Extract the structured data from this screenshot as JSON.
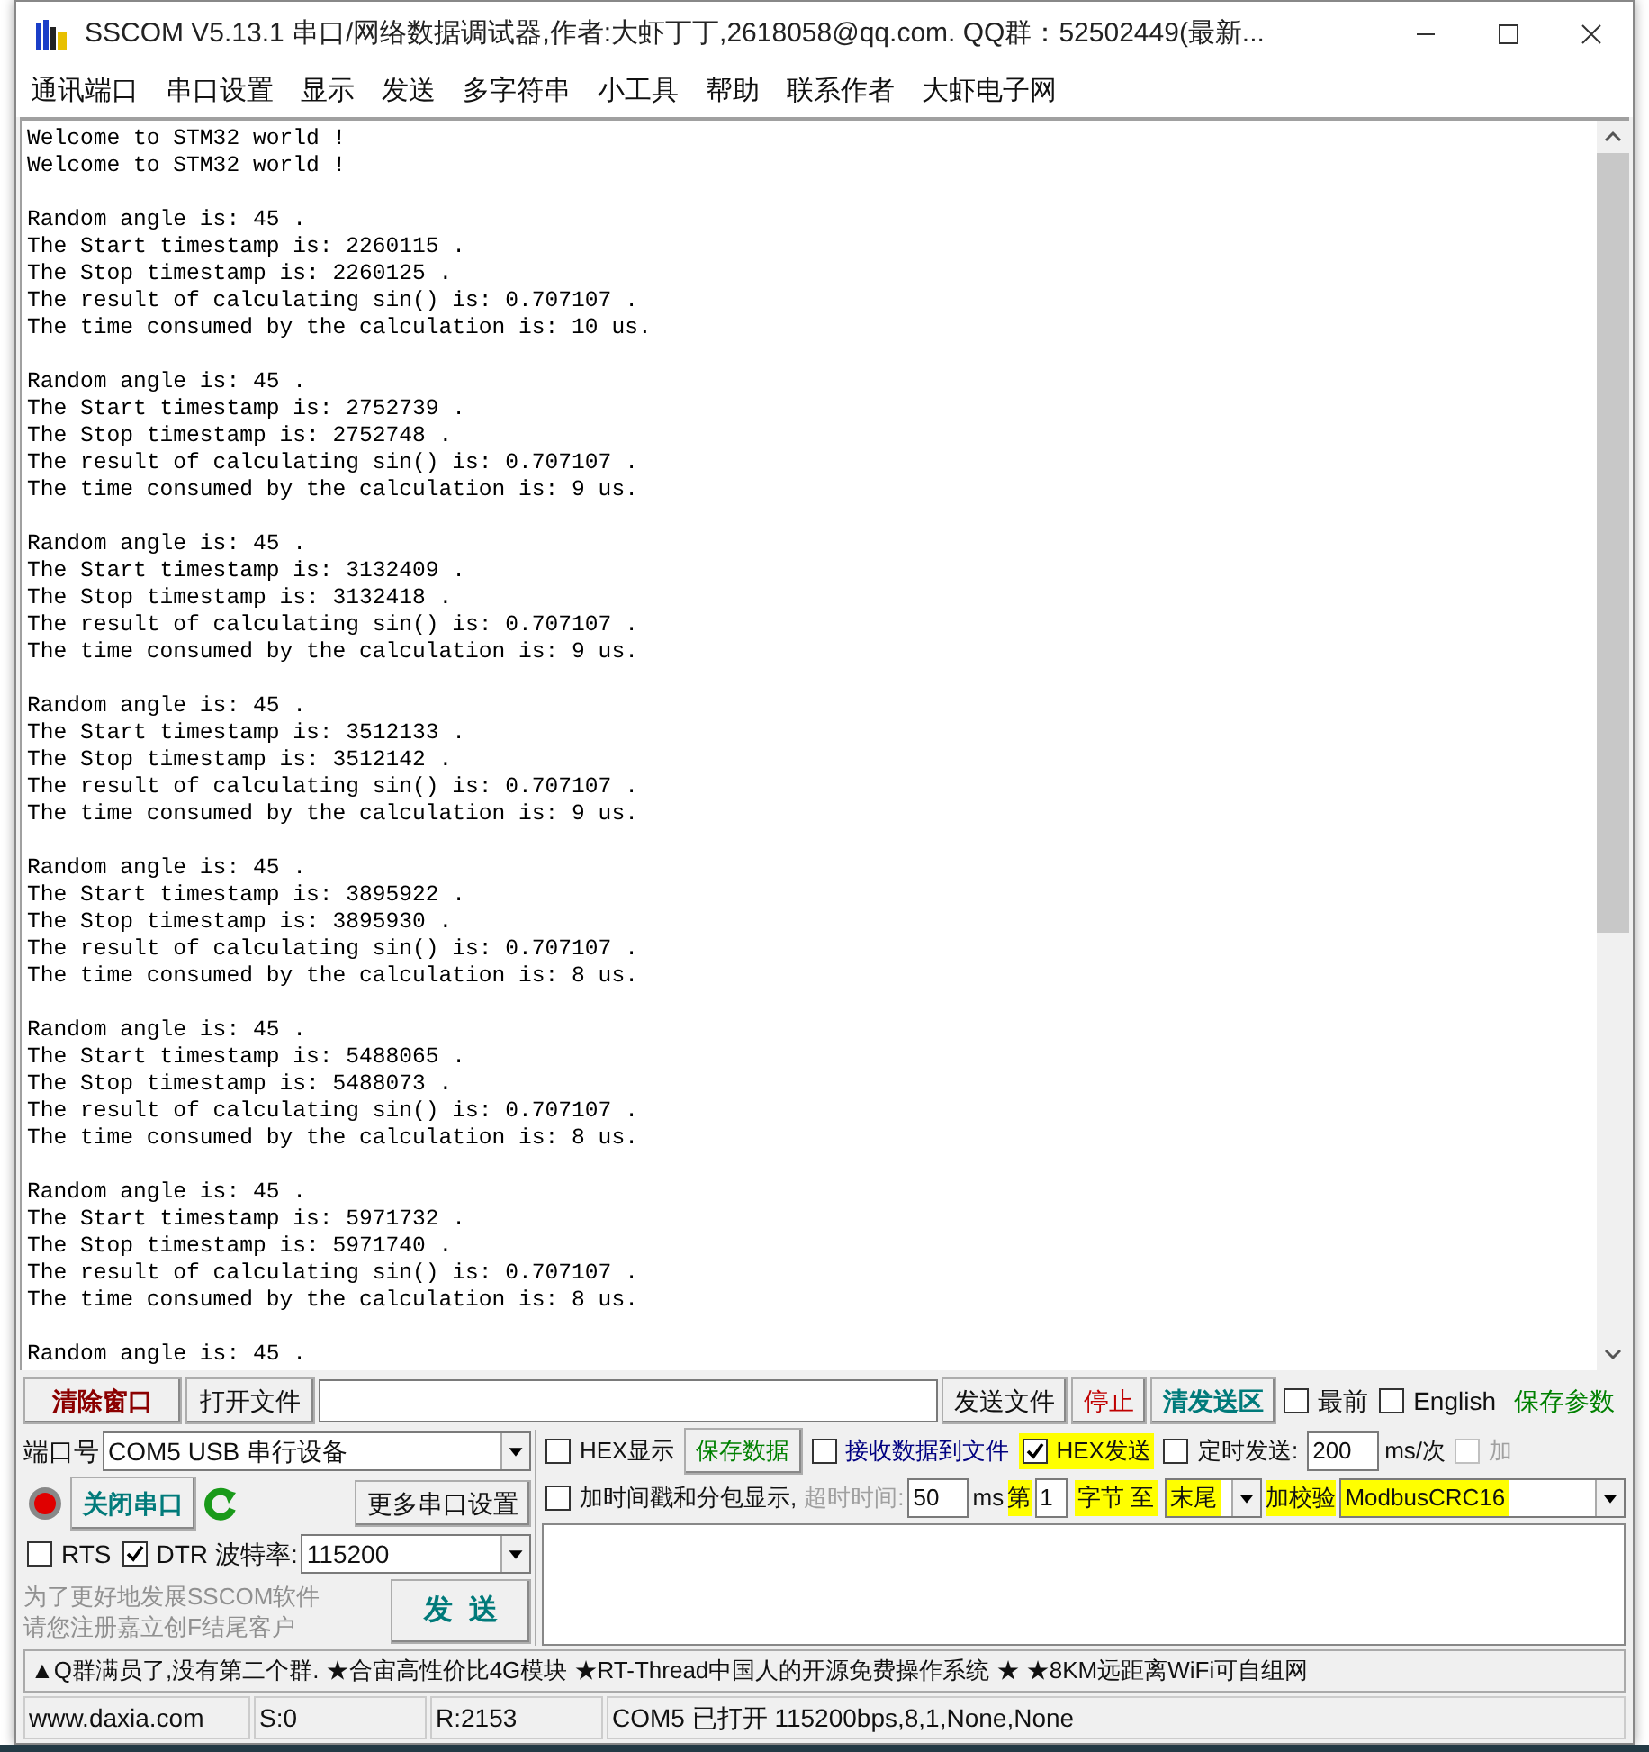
{
  "window": {
    "title": "SSCOM V5.13.1 串口/网络数据调试器,作者:大虾丁丁,2618058@qq.com. QQ群：52502449(最新..."
  },
  "menu": [
    "通讯端口",
    "串口设置",
    "显示",
    "发送",
    "多字符串",
    "小工具",
    "帮助",
    "联系作者",
    "大虾电子网"
  ],
  "log": [
    [
      "Welcome to STM32 world !",
      "Welcome to STM32 world !"
    ],
    [
      "Random angle is: 45 .",
      "The Start timestamp is: 2260115 .",
      "The Stop timestamp is: 2260125 .",
      "The result of calculating sin() is: 0.707107 .",
      "The time consumed by the calculation is: 10 us."
    ],
    [
      "Random angle is: 45 .",
      "The Start timestamp is: 2752739 .",
      "The Stop timestamp is: 2752748 .",
      "The result of calculating sin() is: 0.707107 .",
      "The time consumed by the calculation is: 9 us."
    ],
    [
      "Random angle is: 45 .",
      "The Start timestamp is: 3132409 .",
      "The Stop timestamp is: 3132418 .",
      "The result of calculating sin() is: 0.707107 .",
      "The time consumed by the calculation is: 9 us."
    ],
    [
      "Random angle is: 45 .",
      "The Start timestamp is: 3512133 .",
      "The Stop timestamp is: 3512142 .",
      "The result of calculating sin() is: 0.707107 .",
      "The time consumed by the calculation is: 9 us."
    ],
    [
      "Random angle is: 45 .",
      "The Start timestamp is: 3895922 .",
      "The Stop timestamp is: 3895930 .",
      "The result of calculating sin() is: 0.707107 .",
      "The time consumed by the calculation is: 8 us."
    ],
    [
      "Random angle is: 45 .",
      "The Start timestamp is: 5488065 .",
      "The Stop timestamp is: 5488073 .",
      "The result of calculating sin() is: 0.707107 .",
      "The time consumed by the calculation is: 8 us."
    ],
    [
      "Random angle is: 45 .",
      "The Start timestamp is: 5971732 .",
      "The Stop timestamp is: 5971740 .",
      "The result of calculating sin() is: 0.707107 .",
      "The time consumed by the calculation is: 8 us."
    ],
    [
      "Random angle is: 45 ."
    ]
  ],
  "toolbar": {
    "clear": "清除窗口",
    "open_file": "打开文件",
    "send_file": "发送文件",
    "stop": "停止",
    "clear_send": "清发送区",
    "topmost": {
      "label": "最前",
      "checked": false
    },
    "english": {
      "label": "English",
      "checked": false
    },
    "save_params": "保存参数"
  },
  "port": {
    "label": "端口号",
    "value": "COM5 USB 串行设备",
    "open": true,
    "close_button": "关闭串口",
    "more_settings": "更多串口设置",
    "rts": {
      "label": "RTS",
      "checked": false
    },
    "dtr": {
      "label": "DTR",
      "checked": true
    },
    "baud_label": "波特率:",
    "baud": "115200"
  },
  "promo": [
    "为了更好地发展SSCOM软件",
    "请您注册嘉立创F结尾客户"
  ],
  "send_button": "发  送",
  "options": {
    "hex_display": {
      "label": "HEX显示",
      "checked": false
    },
    "save_data": "保存数据",
    "to_file": {
      "label": "接收数据到文件",
      "checked": false
    },
    "hex_send": {
      "label": "HEX发送",
      "checked": true
    },
    "timed_send": {
      "label": "定时发送:",
      "checked": false
    },
    "interval": "200",
    "interval_unit": "ms/次",
    "append": {
      "label": "加",
      "checked": false,
      "disabled": true
    },
    "timestamp": {
      "label": "加时间戳和分包显示,",
      "checked": false
    },
    "timeout_label": {
      "text": "超时时间:",
      "disabled": true
    },
    "timeout": "50",
    "timeout_unit": "ms",
    "from_label": "第",
    "from_byte": "1",
    "to_label": "字节 至",
    "to": "末尾",
    "checksum_label": "加校验",
    "checksum": "ModbusCRC16"
  },
  "ticker": "▲Q群满员了,没有第二个群. ★合宙高性价比4G模块 ★RT-Thread中国人的开源免费操作系统 ★ ★8KM远距离WiFi可自组网",
  "status_bar": [
    "www.daxia.com",
    "S:0",
    "R:2153",
    "COM5 已打开  115200bps,8,1,None,None"
  ]
}
